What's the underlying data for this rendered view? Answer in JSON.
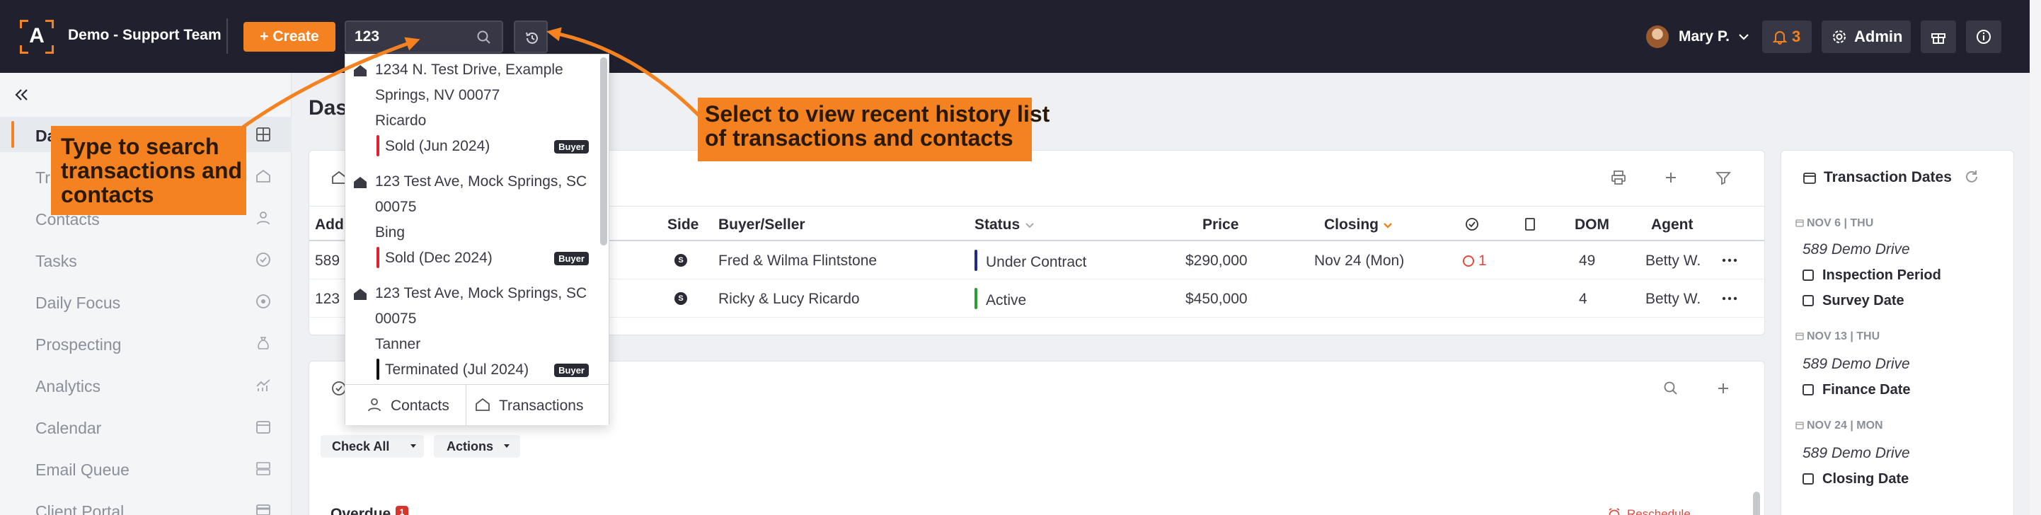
{
  "app": {
    "logo_letter": "A",
    "team_name": "Demo - Support Team",
    "accent": "#f58220"
  },
  "header": {
    "create_label": "Create",
    "create_plus": "+",
    "search_value": "123",
    "user_name": "Mary P.",
    "notification_count": "3",
    "admin_label": "Admin"
  },
  "sidebar": {
    "items": [
      {
        "label": "Dashboard",
        "icon": "grid-icon",
        "active": true
      },
      {
        "label": "Transactions",
        "icon": "home-icon"
      },
      {
        "label": "Contacts",
        "icon": "person-icon"
      },
      {
        "label": "Tasks",
        "icon": "check-circle-icon"
      },
      {
        "label": "Daily Focus",
        "icon": "target-icon"
      },
      {
        "label": "Prospecting",
        "icon": "money-bag-icon"
      },
      {
        "label": "Analytics",
        "icon": "analytics-icon"
      },
      {
        "label": "Calendar",
        "icon": "calendar-icon"
      },
      {
        "label": "Email Queue",
        "icon": "email-queue-icon"
      },
      {
        "label": "Client Portal",
        "icon": "card-icon"
      }
    ]
  },
  "main": {
    "page_title": "Dashboard",
    "table": {
      "columns": [
        "Address",
        "Side",
        "Buyer/Seller",
        "Status",
        "Price",
        "Closing",
        "DOM",
        "Agent"
      ],
      "rows": [
        {
          "address": "589 Demo Drive",
          "side": "S",
          "party": "Fred & Wilma Flintstone",
          "status": "Under Contract",
          "status_color": "#1f2a8c",
          "price": "$290,000",
          "closing": "Nov 24 (Mon)",
          "alerts": "1",
          "dom": "49",
          "agent": "Betty W."
        },
        {
          "address": "123 Demo Drive",
          "side": "S",
          "party": "Ricky & Lucy Ricardo",
          "status": "Active",
          "status_color": "#2a9d3a",
          "price": "$450,000",
          "closing": "",
          "alerts": "",
          "dom": "4",
          "agent": "Betty W."
        }
      ]
    },
    "tasks": {
      "check_all_label": "Check All",
      "actions_label": "Actions",
      "overdue_label": "Overdue",
      "overdue_count": "1",
      "reschedule_label": "Reschedule"
    }
  },
  "transaction_dates": {
    "title": "Transaction Dates",
    "groups": [
      {
        "date": "NOV 6 | THU",
        "property": "589 Demo Drive",
        "tasks": [
          "Inspection Period",
          "Survey Date"
        ]
      },
      {
        "date": "NOV 13 | THU",
        "property": "589 Demo Drive",
        "tasks": [
          "Finance Date"
        ]
      },
      {
        "date": "NOV 24 | MON",
        "property": "589 Demo Drive",
        "tasks": [
          "Closing Date"
        ]
      }
    ]
  },
  "search_results": {
    "items": [
      {
        "lines": [
          "1234 N. Test Drive, Example",
          "Springs, NV 00077",
          "Ricardo"
        ],
        "status": "Sold (Jun 2024)",
        "status_color": "#e5202e",
        "badge": "Buyer"
      },
      {
        "lines": [
          "123 Test Ave, Mock Springs, SC",
          "00075",
          "Bing"
        ],
        "status": "Sold (Dec 2024)",
        "status_color": "#e5202e",
        "badge": "Buyer"
      },
      {
        "lines": [
          "123 Test Ave, Mock Springs, SC",
          "00075",
          "Tanner"
        ],
        "status": "Terminated (Jul 2024)",
        "status_color": "#111111",
        "badge": "Buyer"
      }
    ],
    "tabs": [
      "Contacts",
      "Transactions"
    ]
  },
  "callouts": {
    "search_hint": [
      "Type to search",
      "transactions and",
      "contacts"
    ],
    "history_hint": [
      "Select to view recent history list",
      "of transactions and contacts"
    ]
  }
}
